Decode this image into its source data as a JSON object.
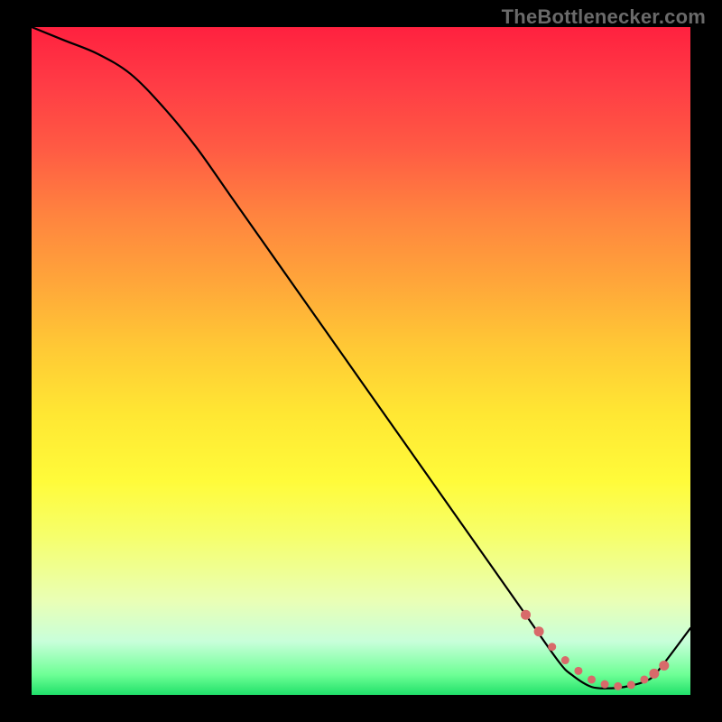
{
  "watermark": "TheBottlenecker.com",
  "chart_data": {
    "type": "line",
    "title": "",
    "xlabel": "",
    "ylabel": "",
    "xlim": [
      0,
      100
    ],
    "ylim": [
      0,
      100
    ],
    "series": [
      {
        "name": "curve",
        "x": [
          0,
          5,
          10,
          15,
          20,
          25,
          30,
          35,
          40,
          45,
          50,
          55,
          60,
          65,
          70,
          75,
          80,
          82,
          85,
          88,
          90,
          93,
          95,
          100
        ],
        "y": [
          100,
          98,
          96,
          93,
          88,
          82,
          75,
          68,
          61,
          54,
          47,
          40,
          33,
          26,
          19,
          12,
          5,
          3,
          1.2,
          1.0,
          1.2,
          2.0,
          3.5,
          10
        ]
      }
    ],
    "markers": {
      "name": "dotted-segment",
      "color": "#d86a6a",
      "x": [
        75,
        77,
        79,
        81,
        83,
        85,
        87,
        89,
        91,
        93,
        94.5,
        96
      ],
      "y": [
        12,
        9.5,
        7.2,
        5.2,
        3.6,
        2.3,
        1.6,
        1.3,
        1.5,
        2.3,
        3.2,
        4.4
      ]
    }
  }
}
